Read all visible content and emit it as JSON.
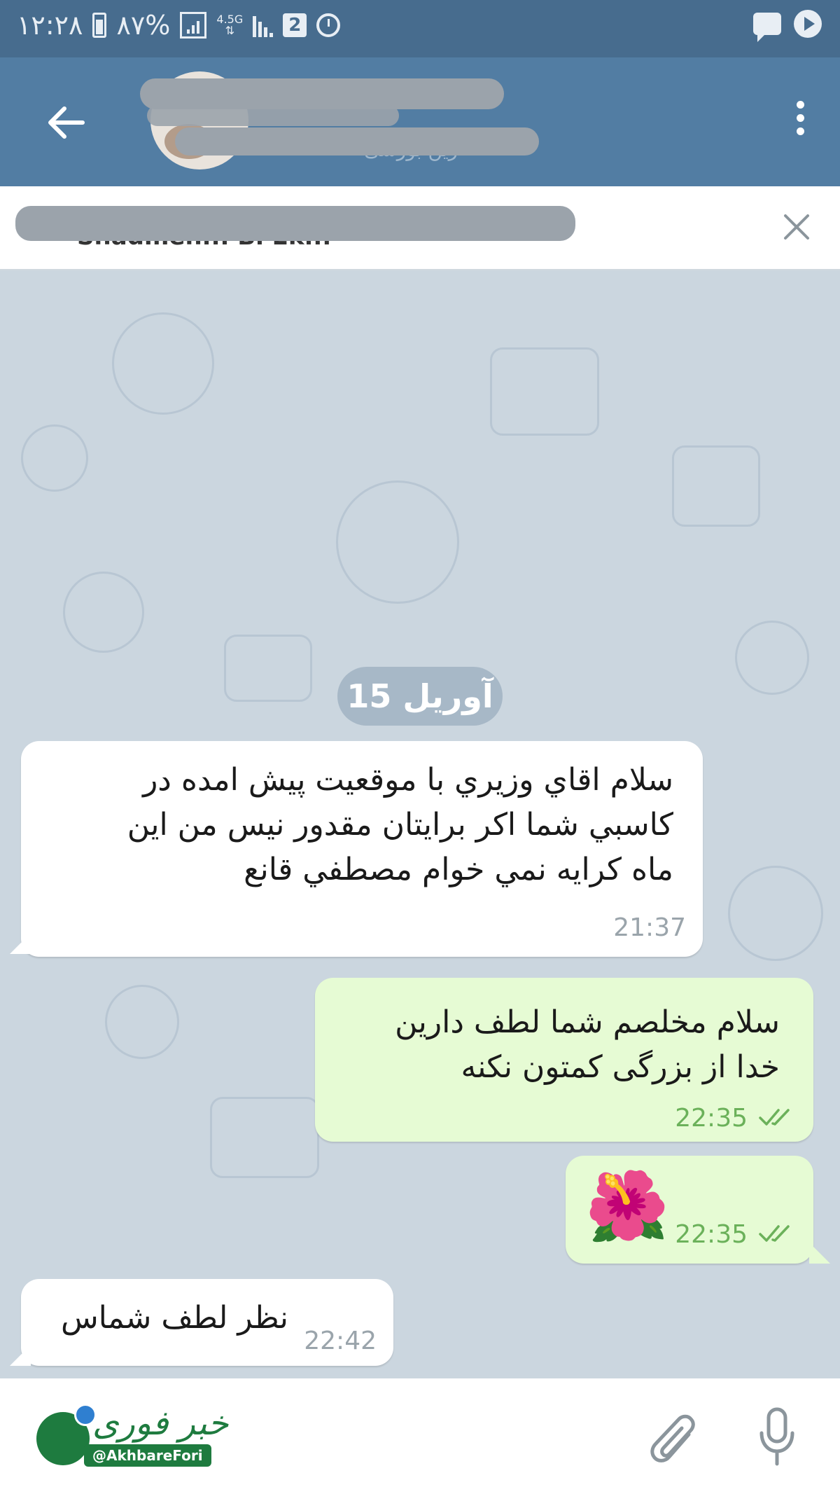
{
  "status_bar": {
    "time": "۱۲:۲۸",
    "battery": "۸۷%",
    "network": "4.5G",
    "sim_badge": "2",
    "icons": [
      "battery-icon",
      "sim-signal-icon",
      "signal-icon",
      "sim2-icon",
      "alarm-icon",
      "message-notification-icon",
      "play-notification-icon"
    ]
  },
  "header": {
    "subtitle_faint": "زین بورسی"
  },
  "pinned": {
    "text": "Shadmeh... Bi Ek..."
  },
  "chat": {
    "date_label": "آوریل 15",
    "messages": [
      {
        "direction": "in",
        "lines": [
          "سلام اقاي وزيري با موقعيت پيش امده در",
          "كاسبي شما اكر برايتان مقدور نيس من اين",
          "ماه كرايه نمي خوام مصطفي قانع"
        ],
        "time": "21:37"
      },
      {
        "direction": "out",
        "lines": [
          "سلام مخلصم شما لطف دارین",
          "خدا از بزرگی کمتون نکنه"
        ],
        "time": "22:35",
        "status": "read"
      },
      {
        "direction": "out",
        "emoji": "🌺",
        "time": "22:35",
        "status": "read"
      },
      {
        "direction": "in",
        "lines": [
          "نظر لطف شماس"
        ],
        "time": "22:42"
      }
    ]
  },
  "bottom_bar": {
    "logo_script": "خبر فوری",
    "logo_handle": "@AkhbareFori",
    "icons": [
      "attach-icon",
      "microphone-icon"
    ]
  },
  "colors": {
    "status_bar": "#476c8e",
    "header": "#527da3",
    "incoming_bubble": "#ffffff",
    "outgoing_bubble": "#e6fbd4",
    "read_ticks": "#6bb15a"
  }
}
